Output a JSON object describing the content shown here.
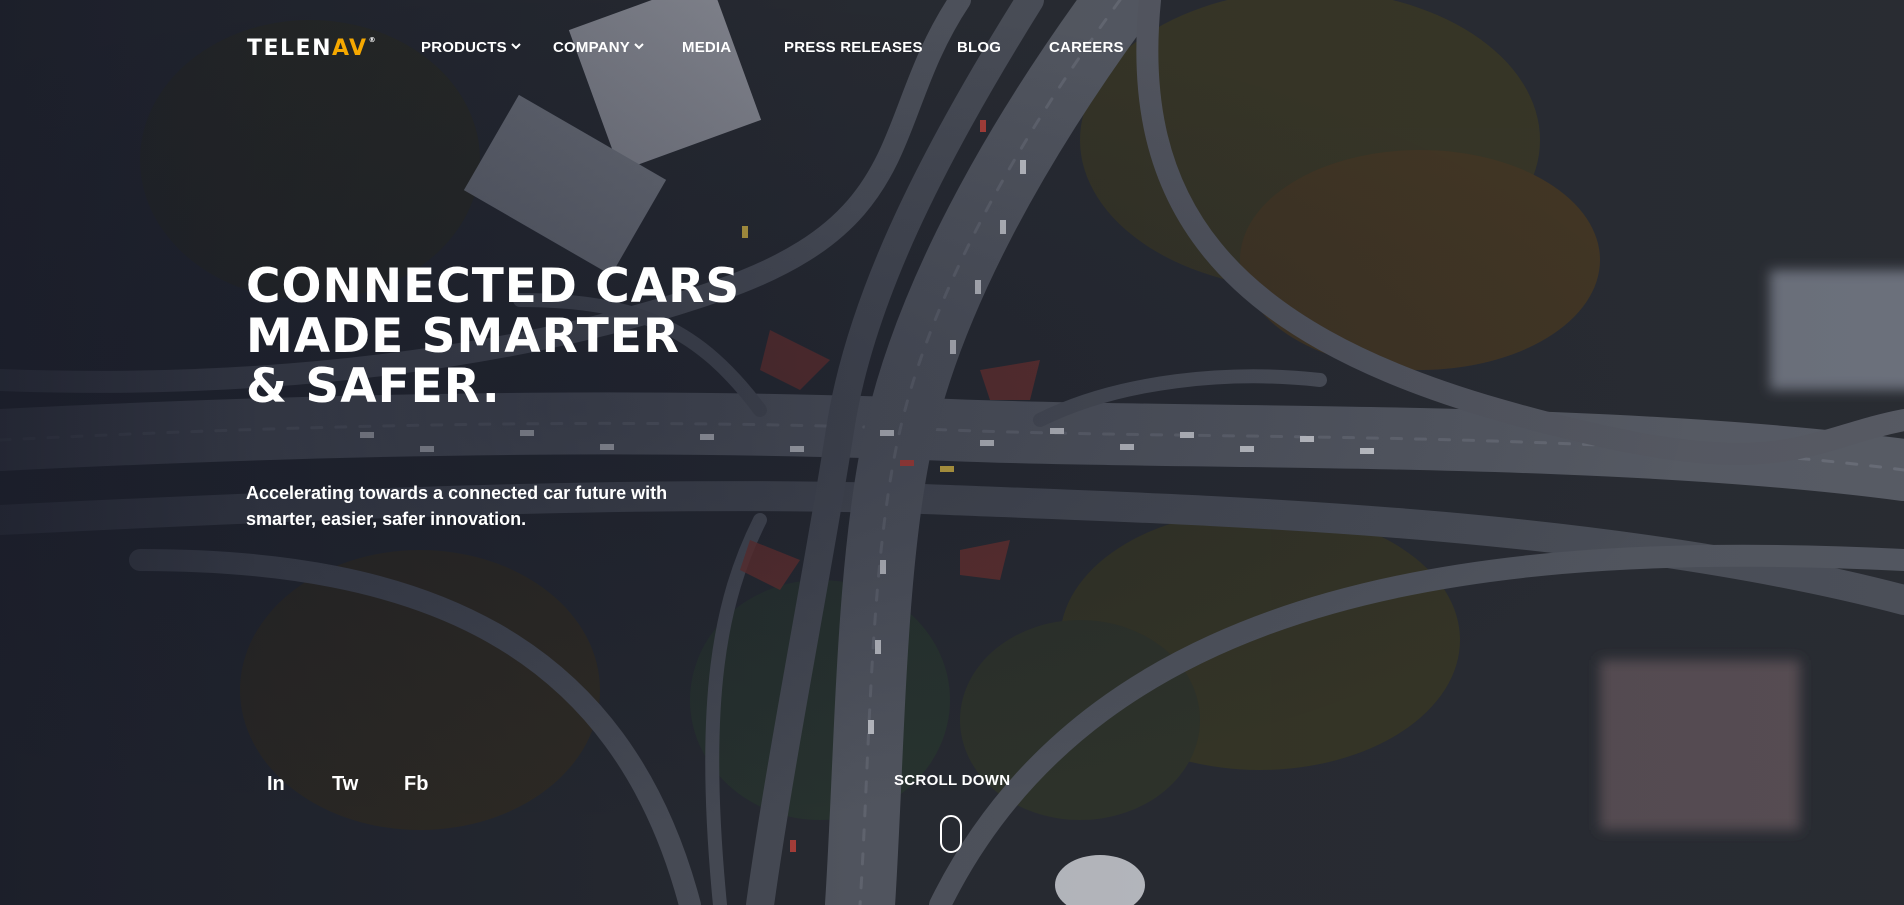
{
  "header": {
    "logo": {
      "text_main": "TELEN",
      "text_accent": "AV",
      "mark": "®",
      "accent_color": "#f5a800"
    },
    "nav": [
      {
        "label": "PRODUCTS",
        "has_dropdown": true
      },
      {
        "label": "COMPANY",
        "has_dropdown": true
      },
      {
        "label": "MEDIA",
        "has_dropdown": false
      },
      {
        "label": "PRESS RELEASES",
        "has_dropdown": false
      },
      {
        "label": "BLOG",
        "has_dropdown": false
      },
      {
        "label": "CAREERS",
        "has_dropdown": false
      }
    ]
  },
  "hero": {
    "title_lines": [
      "CONNECTED CARS",
      "MADE SMARTER",
      "& SAFER."
    ],
    "subtitle": "Accelerating towards a connected car future with smarter, easier, safer innovation."
  },
  "social": [
    {
      "label": "In",
      "icon": "linkedin-icon"
    },
    {
      "label": "Tw",
      "icon": "twitter-icon"
    },
    {
      "label": "Fb",
      "icon": "facebook-icon"
    }
  ],
  "scroll": {
    "label": "SCROLL DOWN",
    "icon": "mouse-icon"
  },
  "colors": {
    "text": "#ffffff",
    "accent": "#f5a800",
    "overlay": "#1d2230"
  }
}
